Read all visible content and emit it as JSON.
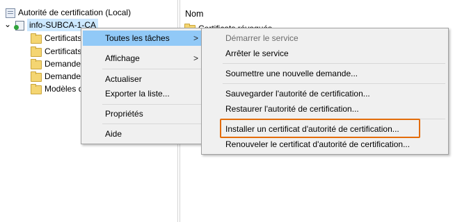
{
  "tree": {
    "root_label": "Autorité de certification (Local)",
    "ca_node_label": "info-SUBCA-1-CA",
    "expander": "⌄",
    "folders": [
      "Certificats",
      "Certificats",
      "Demande",
      "Demande",
      "Modèles d"
    ]
  },
  "list": {
    "column_name": "Nom",
    "partial_row": "Certificats révoqués"
  },
  "context_menu": {
    "items": [
      "Toutes les tâches",
      "Affichage",
      "Actualiser",
      "Exporter la liste...",
      "Propriétés",
      "Aide"
    ],
    "submenu_arrow": ">"
  },
  "submenu": {
    "items": [
      "Démarrer le service",
      "Arrêter le service",
      "Soumettre une nouvelle demande...",
      "Sauvegarder l'autorité de certification...",
      "Restaurer l'autorité de certification...",
      "Installer un certificat d'autorité de certification...",
      "Renouveler le certificat d'autorité de certification..."
    ]
  },
  "colors": {
    "highlight": "#91c9f7",
    "accent_box": "#e36c09"
  }
}
